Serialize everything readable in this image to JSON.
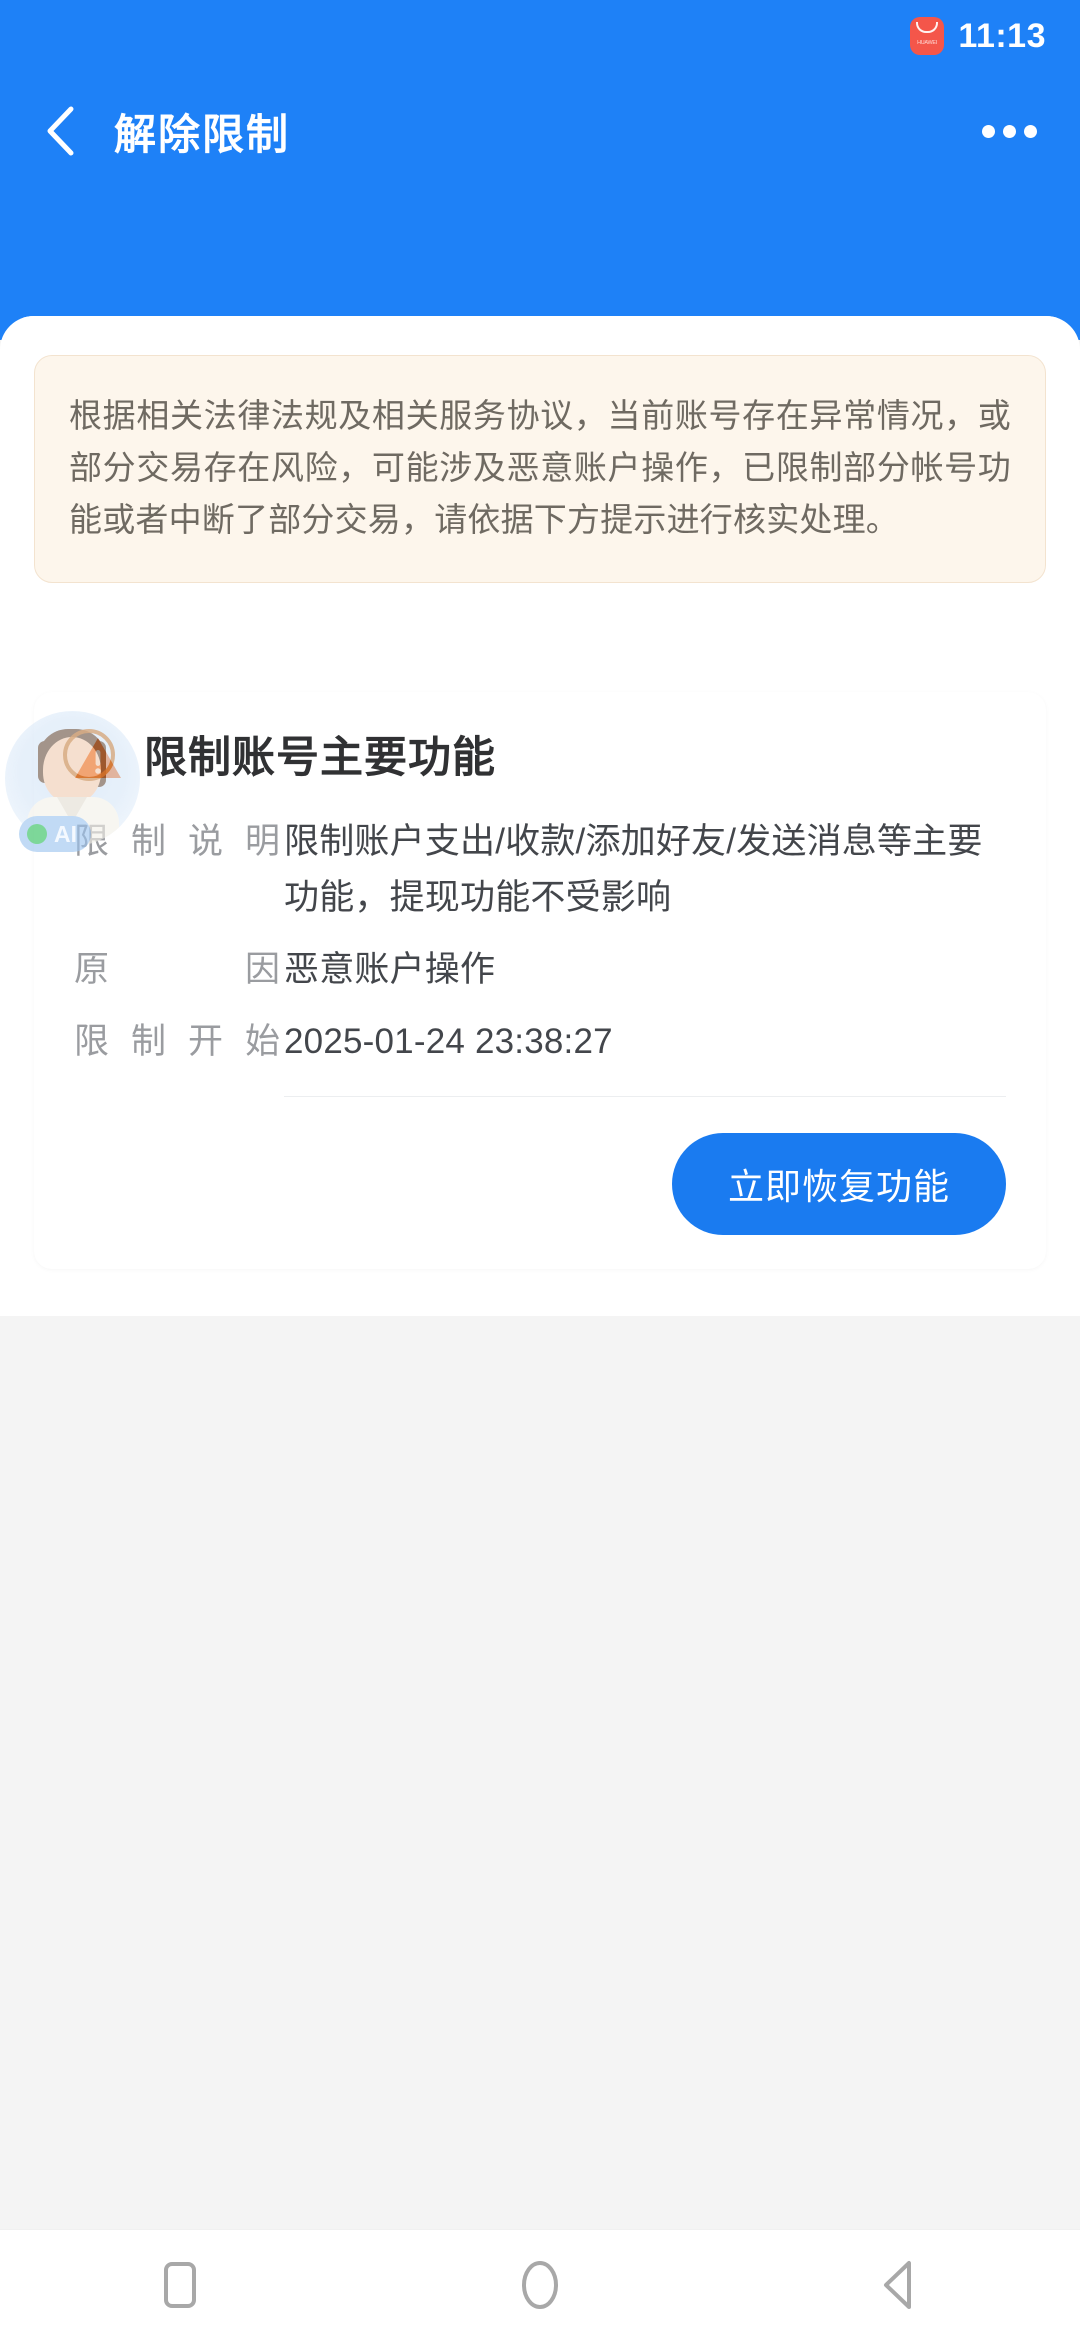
{
  "statusbar": {
    "time": "11:13",
    "app_badge_text": "HUAWEI"
  },
  "header": {
    "title": "解除限制",
    "back_icon": "chevron-left-icon",
    "more_icon": "more-horizontal-icon"
  },
  "notice": {
    "text": "根据相关法律法规及相关服务协议，当前账号存在异常情况，或部分交易存在风险，可能涉及恶意账户操作，已限制部分帐号功能或者中断了部分交易，请依据下方提示进行核实处理。"
  },
  "ai_assistant": {
    "label": "AI",
    "status_dot_color": "#2fbf5c"
  },
  "card": {
    "title": "限制账号主要功能",
    "warn_icon": "warning-triangle-icon",
    "rows": [
      {
        "label": "限制说明",
        "value": "限制账户支出/收款/添加好友/发送消息等主要功能，提现功能不受影响"
      },
      {
        "label": "原因",
        "value": "恶意账户操作"
      },
      {
        "label": "限制开始",
        "value": "2025-01-24 23:38:27"
      }
    ],
    "action_label": "立即恢复功能"
  },
  "android_nav": {
    "recents": "square-recents-icon",
    "home": "circle-home-icon",
    "back": "triangle-back-icon"
  },
  "colors": {
    "brand_blue": "#1e81f7",
    "button_blue": "#1a7bf0",
    "notice_bg": "#fdf6ec",
    "notice_border": "#f3e3cf",
    "warn_orange": "#f4610c",
    "page_bg": "#f4f4f4"
  }
}
